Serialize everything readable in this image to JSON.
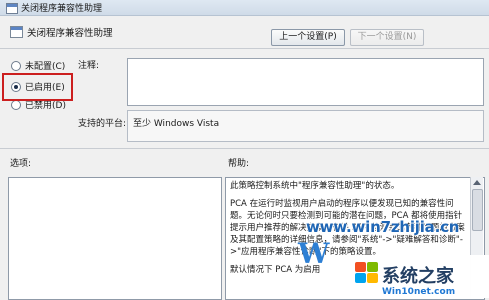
{
  "window": {
    "title": "关闭程序兼容性助理"
  },
  "header": {
    "title": "关闭程序兼容性助理"
  },
  "nav": {
    "prev_label": "上一个设置(P)",
    "next_label": "下一个设置(N)"
  },
  "options": {
    "not_configured": "未配置(C)",
    "enabled": "已启用(E)",
    "disabled": "已禁用(D)",
    "selected": "enabled"
  },
  "comment": {
    "label": "注释:",
    "value": ""
  },
  "platform": {
    "label": "支持的平台:",
    "value": "至少 Windows Vista"
  },
  "sections": {
    "options_label": "选项:",
    "help_label": "帮助:"
  },
  "help": {
    "paragraphs": [
      "此策略控制系统中\"程序兼容性助理\"的状态。",
      "PCA 在运行时监视用户启动的程序以便发现已知的兼容性问题。无论何时只要检测到可能的潜在问题，PCA 都将使用指针提示用户推荐的解决方案。有关 PCA 检测到的各种问题的方案及其配置策略的详细信息，请参阅\"系统\"->\"疑难解答和诊断\"->\"应用程序兼容性诊断\"下的策略设置。",
      "默认情况下 PCA 为启用"
    ]
  },
  "watermark": {
    "site": "www.win7zhijia.cn",
    "logo_letter": "W",
    "brand_main": "系统之家",
    "brand_sub": "Win10net.com"
  },
  "colors": {
    "highlight": "#cc1f1f",
    "watermark_blue": "#1f66b5"
  }
}
